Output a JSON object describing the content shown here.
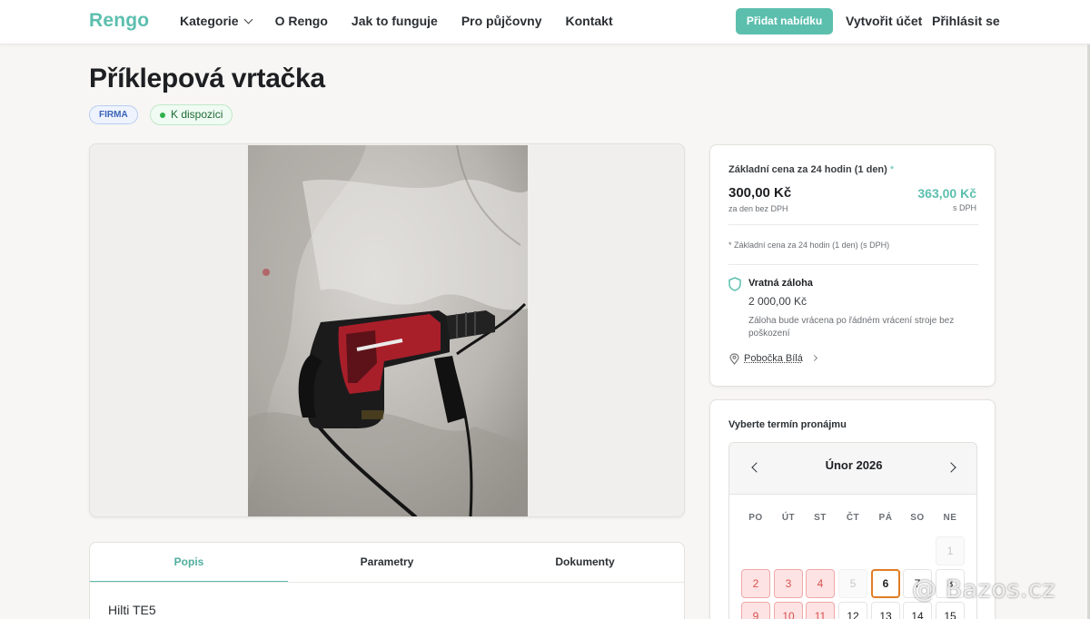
{
  "header": {
    "logo": "Rengo",
    "nav": [
      "Kategorie",
      "O Rengo",
      "Jak to funguje",
      "Pro půjčovny",
      "Kontakt"
    ],
    "add_offer": "Přidat nabídku",
    "create_account": "Vytvořit účet",
    "login": "Přihlásit se"
  },
  "product": {
    "title": "Příklepová vrtačka",
    "badge_type": "FIRMA",
    "badge_status": "K dispozici"
  },
  "tabs": {
    "items": [
      "Popis",
      "Parametry",
      "Dokumenty"
    ],
    "active": "Popis",
    "description": "Hilti TE5"
  },
  "pricing": {
    "heading": "Základní cena za 24 hodin (1 den)",
    "heading_mark": "*",
    "price": "300,00 Kč",
    "price_note": "za den bez DPH",
    "price_vat": "363,00 Kč",
    "price_vat_note": "s DPH",
    "footnote": "* Základní cena za 24 hodin (1 den) (s DPH)",
    "deposit_title": "Vratná záloha",
    "deposit_value": "2 000,00 Kč",
    "deposit_note": "Záloha bude vrácena po řádném vrácení stroje bez poškození",
    "branch": "Pobočka Bílá"
  },
  "calendar": {
    "title": "Vyberte termín pronájmu",
    "month": "Únor 2026",
    "weekdays": [
      "PO",
      "ÚT",
      "ST",
      "ČT",
      "PÁ",
      "SO",
      "NE"
    ],
    "row1": [
      "1"
    ],
    "row2": [
      "2",
      "3",
      "4",
      "5",
      "6",
      "7",
      "8"
    ],
    "row3": [
      "9",
      "10",
      "11",
      "12",
      "13",
      "14",
      "15"
    ]
  },
  "watermark": "@ Bazos.cz",
  "colors": {
    "brand": "#5cbfae",
    "busy": "#d85050",
    "today": "#e07d26",
    "available": "#2fb24f"
  }
}
